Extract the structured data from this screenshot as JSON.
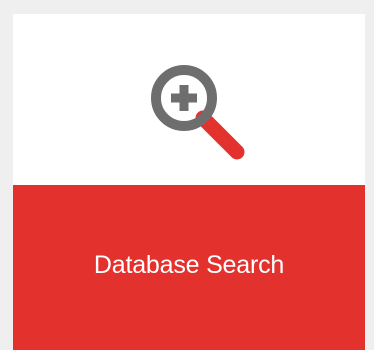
{
  "tile": {
    "label": "Database Search",
    "icon": "magnifier-plus-icon"
  },
  "colors": {
    "accent": "#e3322e",
    "icon_gray": "#6e6e6e",
    "background": "#efefef",
    "tile": "#ffffff"
  }
}
